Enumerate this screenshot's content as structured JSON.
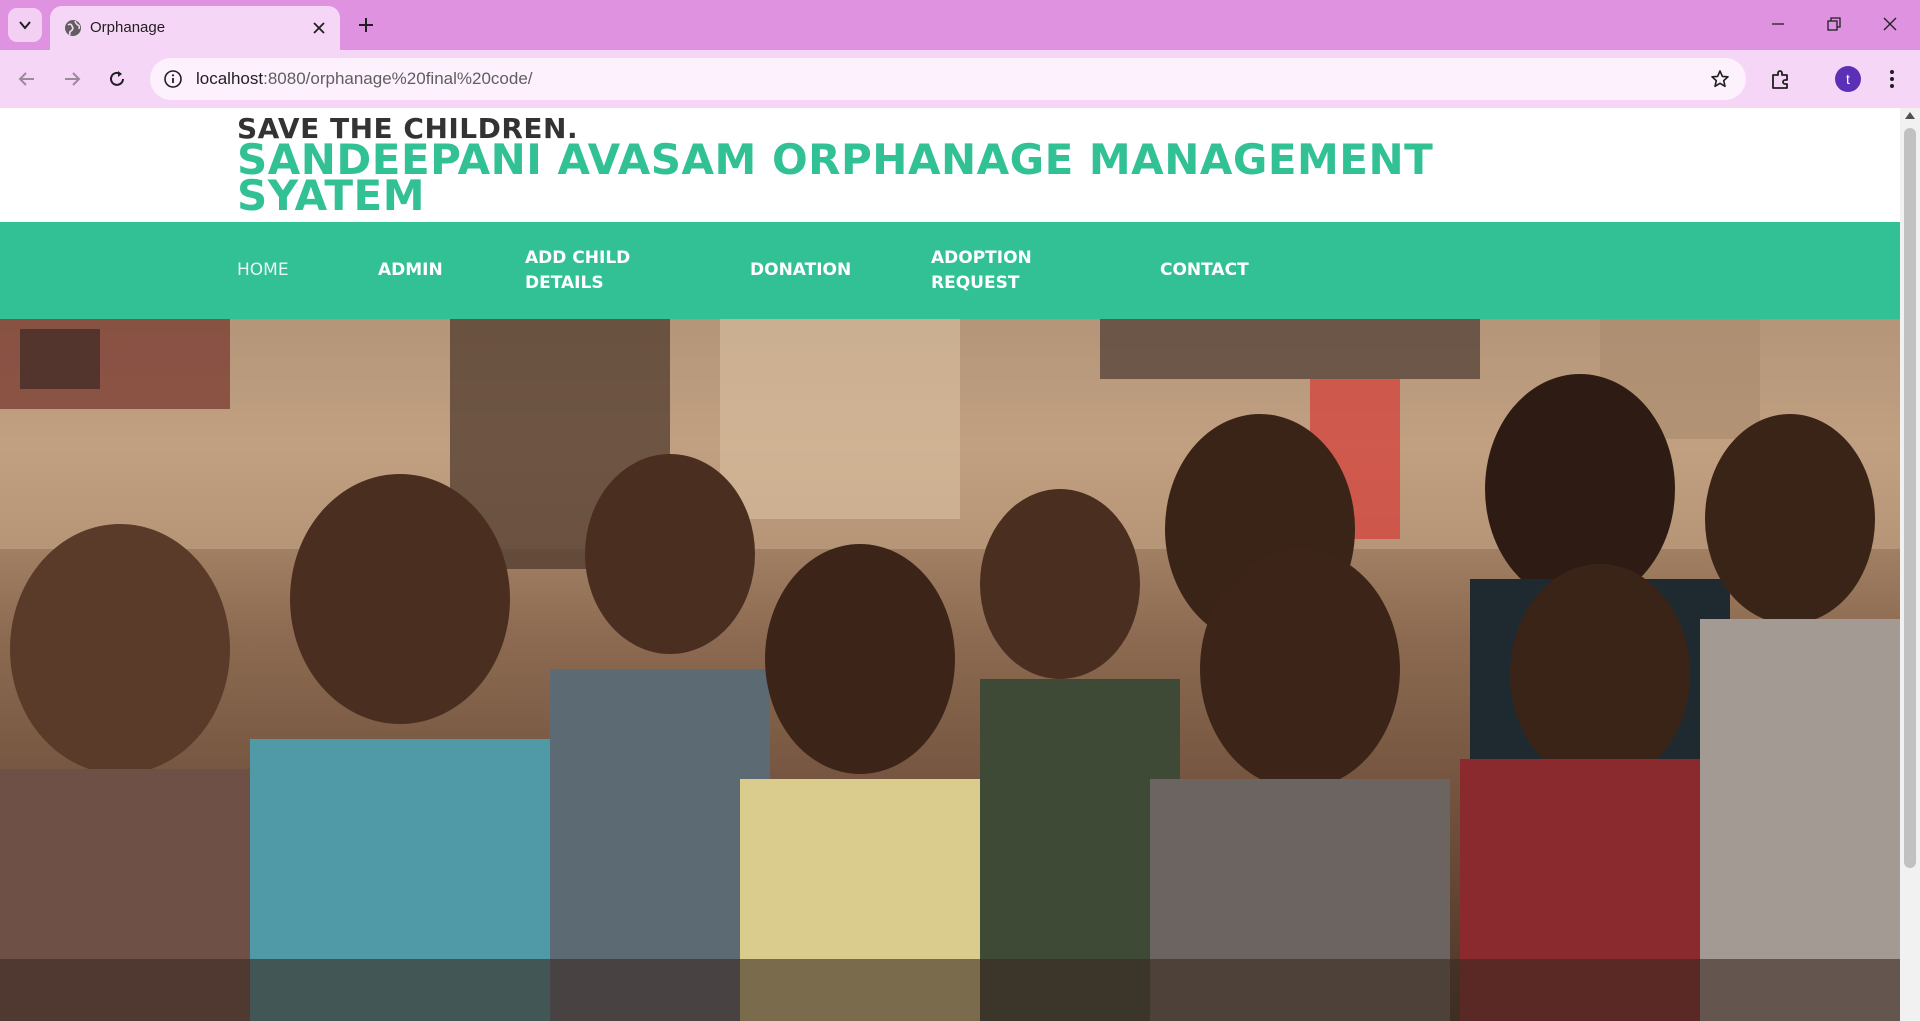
{
  "browser": {
    "tab": {
      "title": "Orphanage"
    },
    "address_bar": {
      "host": "localhost",
      "path": ":8080/orphanage%20final%20code/"
    },
    "profile_initial": "t"
  },
  "page": {
    "tagline": "SAVE THE CHILDREN.",
    "title": "SANDEEPANI AVASAM ORPHANAGE MANAGEMENT SYATEM",
    "nav": {
      "home": "HOME",
      "admin": "ADMIN",
      "add_child_1": "ADD CHILD",
      "add_child_2": "DETAILS",
      "donation": "DONATION",
      "adoption_1": "ADOPTION",
      "adoption_2": "REQUEST",
      "contact": "CONTACT"
    }
  },
  "colors": {
    "accent": "#32c095",
    "tabbar": "#df92df",
    "toolbar": "#f6d6f6"
  }
}
